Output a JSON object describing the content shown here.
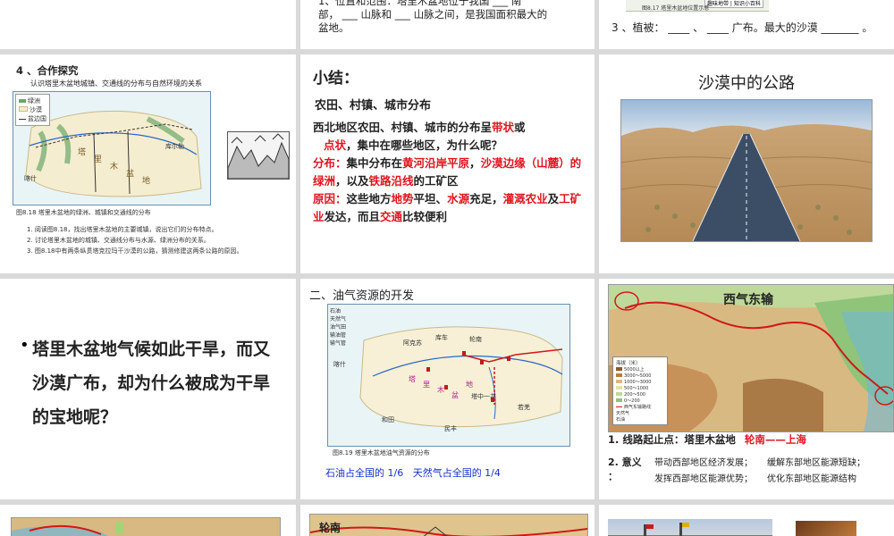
{
  "s1": {
    "text1": "1、位置和范围：塔里木盆地位于我国 ___ 南",
    "text2": "部， ___ 山脉和 ___ 山脉之间，是我国面积最大的",
    "text3": "盆地。"
  },
  "s3": {
    "legend_btn": "趣味地带 | 知识小百科",
    "caption": "图8.17 塔里木盆地位置示意",
    "text": "3 、植被： ____ 、 ____ 广布。最大的沙漠 _______ 。"
  },
  "s4": {
    "heading": "4 、合作探究",
    "subtitle": "认识塔里木盆地城镇、交通线的分布与自然环境的关系",
    "legend": [
      "绿洲",
      "沙漠",
      "盆边国"
    ],
    "map_labels": [
      "喀什",
      "塔",
      "里",
      "木",
      "盆",
      "地",
      "库尔勒"
    ],
    "caption": "图8.18 塔里木盆地的绿洲、城镇和交通线的分布",
    "questions": [
      "1. 阅读图8.18，找出塔里木盆地的主要城镇，说出它们的分布特点。",
      "2. 讨论塔里木盆地的城镇、交通线分布与水源、绿洲分布的关系。",
      "3. 图8.18中有两条纵贯塔克拉玛干沙漠的公路，猜测修建这两条公路的原因。"
    ]
  },
  "s5": {
    "title": "小结：",
    "subheading": "农田、村镇、城市分布",
    "p1_a": "西北地区农田、村镇、城市的分布呈",
    "p1_b": "带状",
    "p1_c": "或",
    "p1_d": "点状",
    "p1_e": "，集中在哪些地区，为什么呢？",
    "p2_label": "分布：",
    "p2_a": "集中分布在",
    "p2_b": "黄河沿岸平原",
    "p2_c": "，",
    "p2_d": "沙漠边缘（山麓）的绿洲",
    "p2_e": "，以及",
    "p2_f": "铁路沿线",
    "p2_g": "的工矿区",
    "p3_label": "原因：",
    "p3_a": "这些地方",
    "p3_b": "地势",
    "p3_c": "平坦、",
    "p3_d": "水源",
    "p3_e": "充足，",
    "p3_f": "灌溉农业",
    "p3_g": "及",
    "p3_h": "工矿业",
    "p3_i": "发达，而且",
    "p3_j": "交通",
    "p3_k": "比较便利"
  },
  "s6": {
    "title": "沙漠中的公路"
  },
  "s7": {
    "question": "塔里木盆地气候如此干旱，而又沙漠广布，却为什么被成为干旱的宝地呢？"
  },
  "s8": {
    "heading": "二、油气资源的开发",
    "legend": [
      "石油",
      "天然气",
      "油气田",
      "输油管",
      "输气管"
    ],
    "map_labels": [
      "喀什",
      "库车",
      "轮南",
      "阿克苏",
      "塔中一井",
      "和田",
      "民丰",
      "若羌",
      "塔",
      "里",
      "木",
      "盆",
      "地"
    ],
    "caption": "图8.19 塔里木盆地油气资源的分布",
    "stat": "石油占全国的 1/6   天然气占全国的 1/4"
  },
  "s9": {
    "title": "西气东输",
    "legend_title": "海拔（米）",
    "legend": [
      "5000以上",
      "3000～5000",
      "1000～3000",
      "500～1000",
      "200～500",
      "0～200",
      "西气东输路线",
      "天然气",
      "石油"
    ],
    "line_label": "1. 线路起止点：塔里木盆地",
    "line_red": "轮南——上海",
    "meaning_label": "2. 意义",
    "meaning_colon": "：",
    "meaning_rows": [
      [
        "带动西部地区经济发展；",
        "缓解东部地区能源短缺；"
      ],
      [
        "发挥西部地区能源优势；",
        "优化东部地区能源结构"
      ]
    ]
  },
  "s11": {
    "label": "轮南"
  }
}
